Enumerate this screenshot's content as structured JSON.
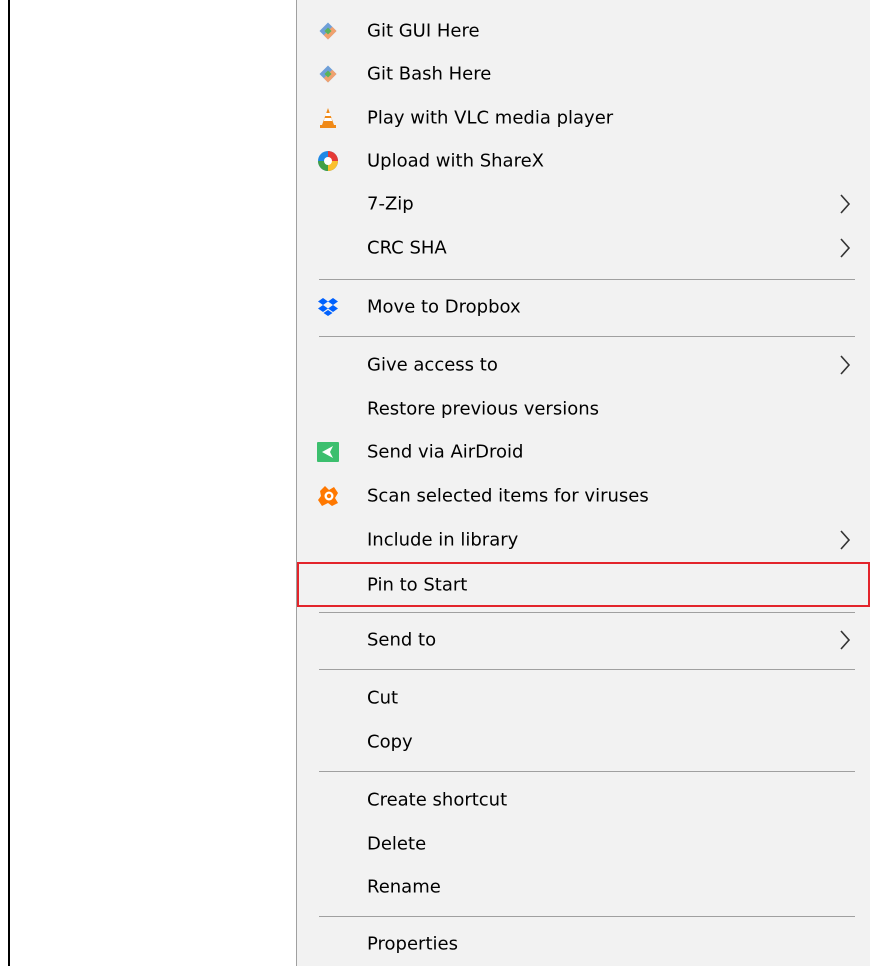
{
  "menu": {
    "items": [
      {
        "label": "Git GUI Here",
        "icon": "git-icon",
        "submenu": false
      },
      {
        "label": "Git Bash Here",
        "icon": "git-icon",
        "submenu": false
      },
      {
        "label": "Play with VLC media player",
        "icon": "vlc-cone-icon",
        "submenu": false
      },
      {
        "label": "Upload with ShareX",
        "icon": "sharex-icon",
        "submenu": false
      },
      {
        "label": "7-Zip",
        "icon": "",
        "submenu": true
      },
      {
        "label": "CRC SHA",
        "icon": "",
        "submenu": true
      },
      {
        "label": "Move to Dropbox",
        "icon": "dropbox-icon",
        "submenu": false
      },
      {
        "label": "Give access to",
        "icon": "",
        "submenu": true
      },
      {
        "label": "Restore previous versions",
        "icon": "",
        "submenu": false
      },
      {
        "label": "Send via AirDroid",
        "icon": "airdroid-icon",
        "submenu": false
      },
      {
        "label": "Scan selected items for viruses",
        "icon": "avast-icon",
        "submenu": false
      },
      {
        "label": "Include in library",
        "icon": "",
        "submenu": true
      },
      {
        "label": "Pin to Start",
        "icon": "",
        "submenu": false,
        "highlighted": true
      },
      {
        "label": "Send to",
        "icon": "",
        "submenu": true
      },
      {
        "label": "Cut",
        "icon": "",
        "submenu": false
      },
      {
        "label": "Copy",
        "icon": "",
        "submenu": false
      },
      {
        "label": "Create shortcut",
        "icon": "",
        "submenu": false
      },
      {
        "label": "Delete",
        "icon": "",
        "submenu": false
      },
      {
        "label": "Rename",
        "icon": "",
        "submenu": false
      },
      {
        "label": "Properties",
        "icon": "",
        "submenu": false
      }
    ]
  },
  "colors": {
    "menu_background": "#f2f2f2",
    "highlight_border": "#e3242b",
    "separator": "#a0a0a0"
  }
}
